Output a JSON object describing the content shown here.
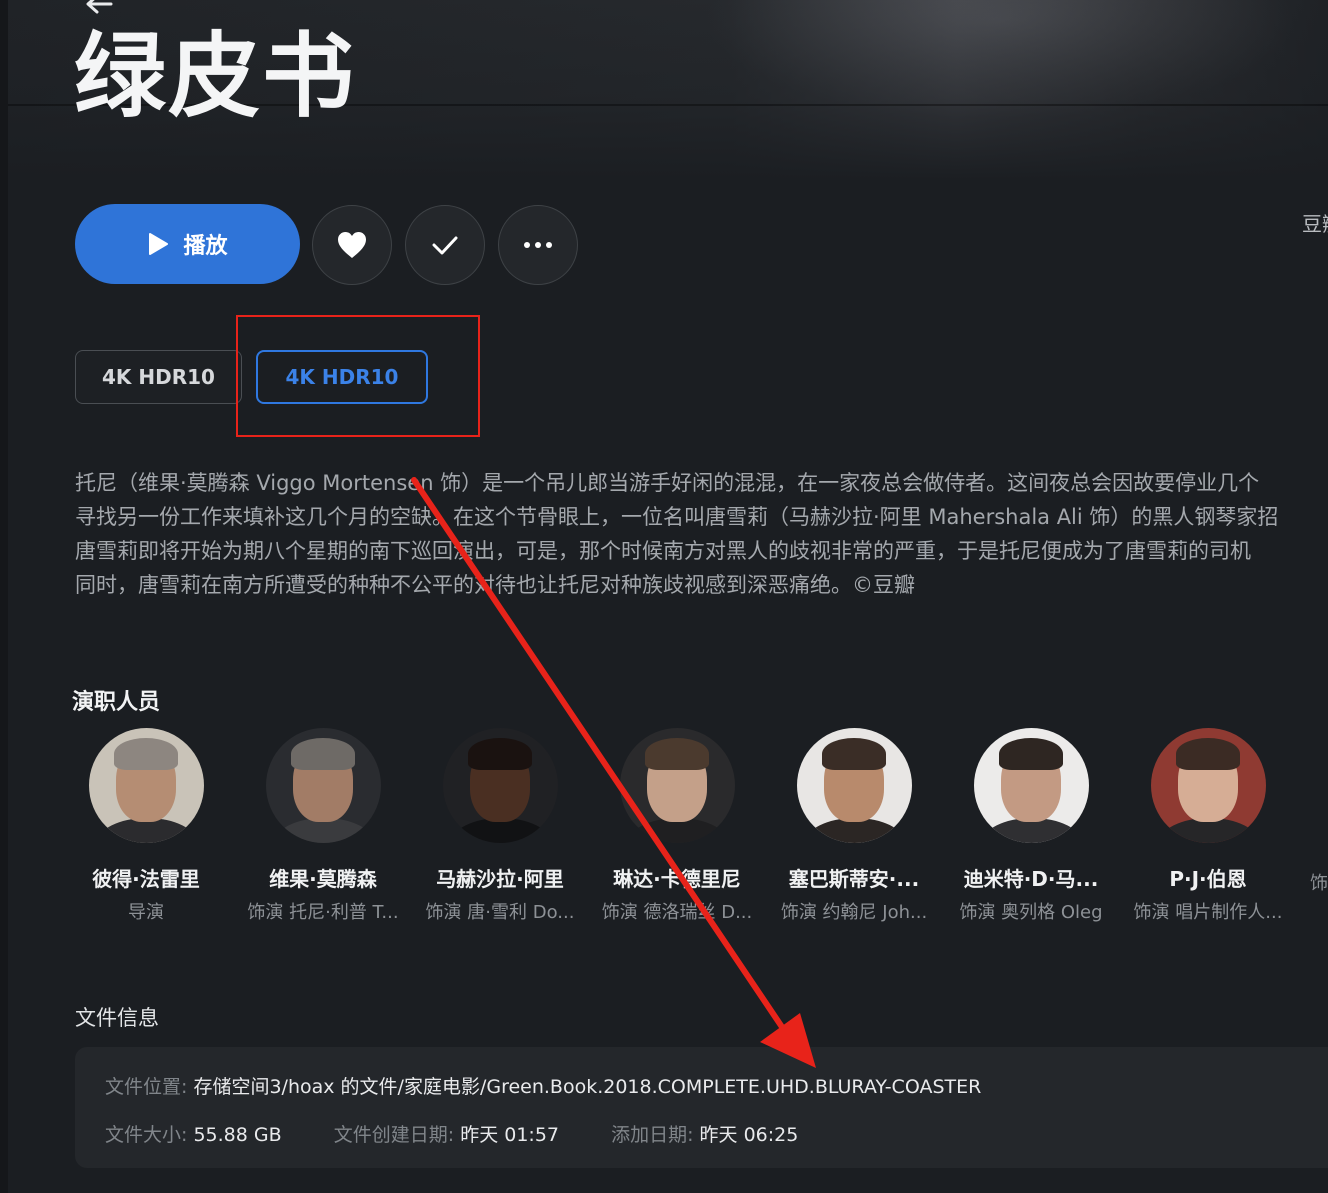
{
  "title": "绿皮书",
  "actions": {
    "play_label": "播放",
    "favorite_icon": "heart-icon",
    "watched_icon": "check-icon",
    "more_icon": "more-horizontal-icon"
  },
  "rating_peek": "豆瓣",
  "versions": [
    {
      "label": "4K HDR10",
      "selected": false
    },
    {
      "label": "4K HDR10",
      "selected": true
    }
  ],
  "synopsis": {
    "lines": [
      "托尼（维果·莫腾森 Viggo Mortensen 饰）是一个吊儿郎当游手好闲的混混，在一家夜总会做侍者。这间夜总会因故要停业几个",
      "寻找另一份工作来填补这几个月的空缺。在这个节骨眼上，一位名叫唐雪莉（马赫沙拉·阿里 Mahershala Ali 饰）的黑人钢琴家招",
      "唐雪莉即将开始为期八个星期的南下巡回演出，可是，那个时候南方对黑人的歧视非常的严重，于是托尼便成为了唐雪莉的司机",
      "同时，唐雪莉在南方所遭受的种种不公平的对待也让托尼对种族歧视感到深恶痛绝。©豆瓣"
    ]
  },
  "cast": {
    "heading": "演职人员",
    "members": [
      {
        "name": "彼得·法雷里",
        "role": "导演"
      },
      {
        "name": "维果·莫腾森",
        "role": "饰演 托尼·利普 T..."
      },
      {
        "name": "马赫沙拉·阿里",
        "role": "饰演 唐·雪利 Do..."
      },
      {
        "name": "琳达·卡德里尼",
        "role": "饰演 德洛瑞丝 D..."
      },
      {
        "name": "塞巴斯蒂安·...",
        "role": "饰演 约翰尼 Joh..."
      },
      {
        "name": "迪米特·D·马...",
        "role": "饰演 奥列格 Oleg"
      },
      {
        "name": "P·J·伯恩",
        "role": "饰演 唱片制作人..."
      },
      {
        "name": "",
        "role": "饰"
      }
    ]
  },
  "file_info": {
    "heading": "文件信息",
    "location_label": "文件位置:",
    "location_value": "存储空间3/hoax 的文件/家庭电影/Green.Book.2018.COMPLETE.UHD.BLURAY-COASTER",
    "size_label": "文件大小:",
    "size_value": "55.88 GB",
    "created_label": "文件创建日期:",
    "created_value": "昨天 01:57",
    "added_label": "添加日期:",
    "added_value": "昨天 06:25"
  },
  "colors": {
    "accent": "#2f74d8",
    "background": "#1b1e22",
    "annotation": "#e8231a"
  }
}
